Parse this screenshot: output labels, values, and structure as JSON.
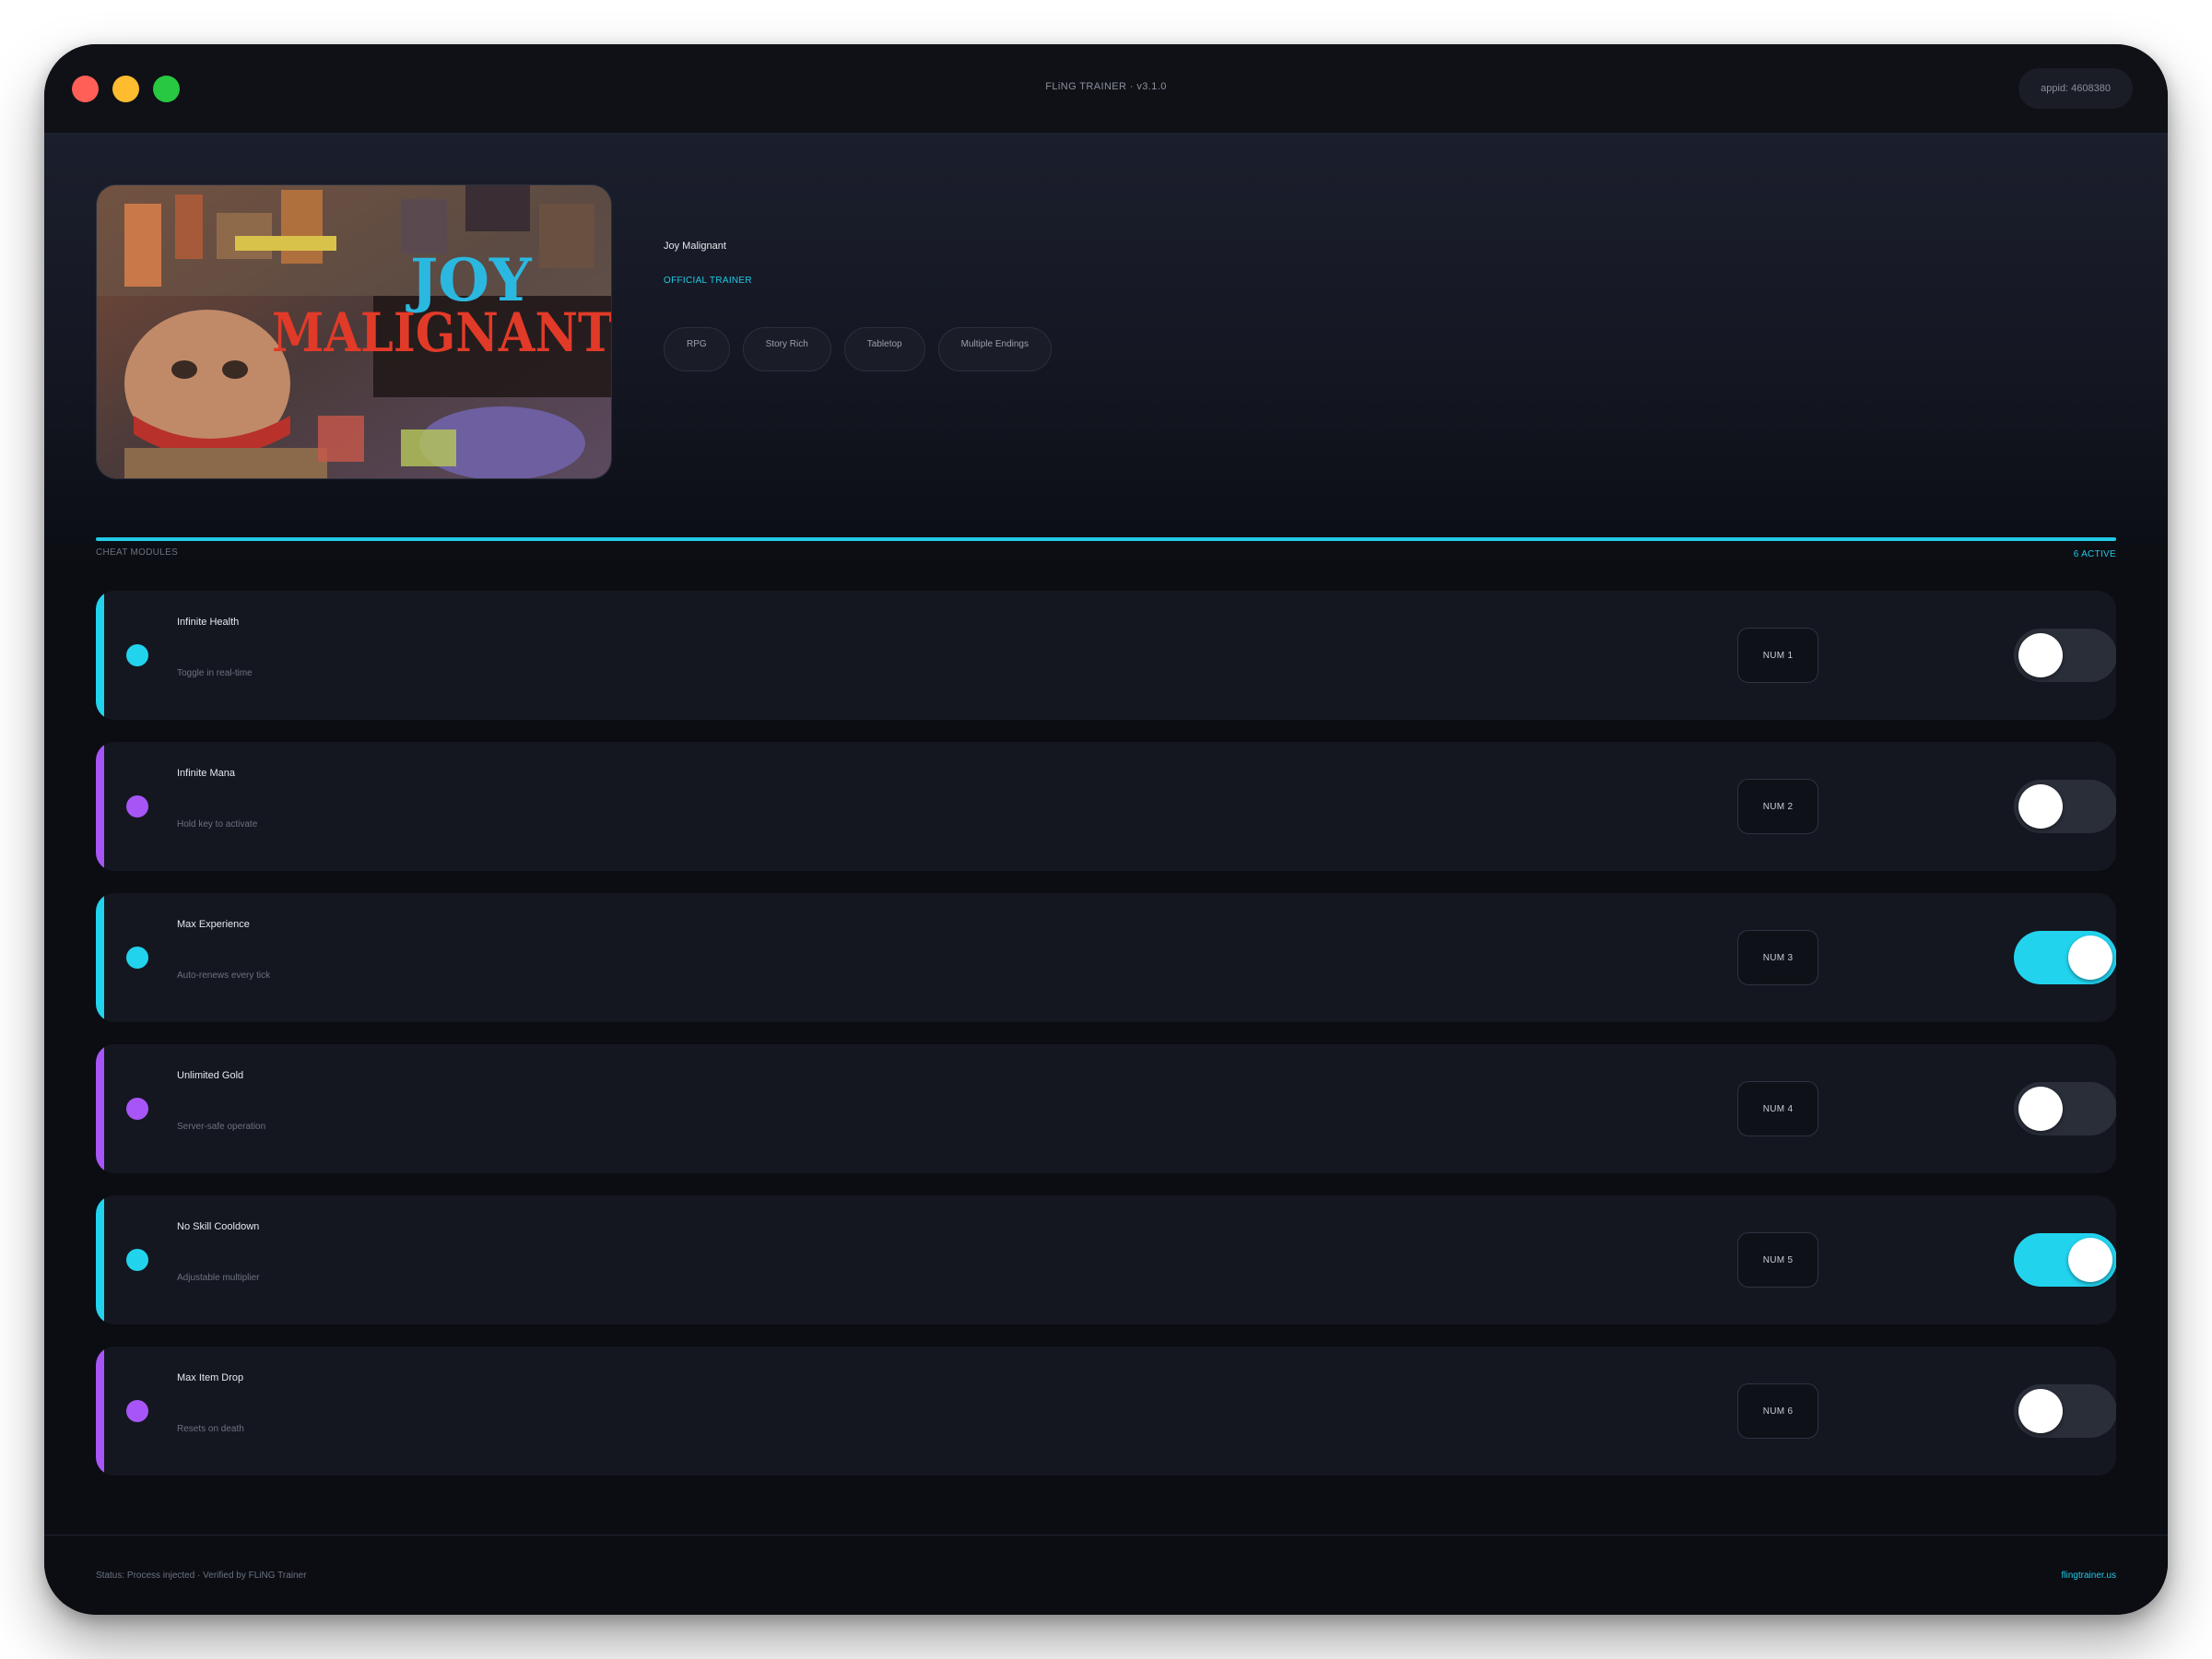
{
  "window": {
    "title": "FLiNG TRAINER · v3.1.0",
    "appid": "appid: 4608380"
  },
  "game": {
    "name": "Joy Malignant",
    "badge": "OFFICIAL TRAINER",
    "cover_title_line1": "JOY",
    "cover_title_line2": "MALIGNANT",
    "tags": [
      "RPG",
      "Story Rich",
      "Tabletop",
      "Multiple Endings"
    ]
  },
  "section": {
    "label": "CHEAT MODULES",
    "count": "6 ACTIVE"
  },
  "colors": {
    "cyan": "#22d3ee",
    "purple": "#a855f7",
    "toggle_off": "#2a2e39"
  },
  "cheats": [
    {
      "name": "Infinite Health",
      "desc": "Toggle in real-time",
      "key": "NUM 1",
      "accent": "#22d3ee",
      "on": false
    },
    {
      "name": "Infinite Mana",
      "desc": "Hold key to activate",
      "key": "NUM 2",
      "accent": "#a855f7",
      "on": false
    },
    {
      "name": "Max Experience",
      "desc": "Auto-renews every tick",
      "key": "NUM 3",
      "accent": "#22d3ee",
      "on": true
    },
    {
      "name": "Unlimited Gold",
      "desc": "Server-safe operation",
      "key": "NUM 4",
      "accent": "#a855f7",
      "on": false
    },
    {
      "name": "No Skill Cooldown",
      "desc": "Adjustable multiplier",
      "key": "NUM 5",
      "accent": "#22d3ee",
      "on": true
    },
    {
      "name": "Max Item Drop",
      "desc": "Resets on death",
      "key": "NUM 6",
      "accent": "#a855f7",
      "on": false
    }
  ],
  "footer": {
    "status": "Status: Process injected · Verified by FLiNG Trainer",
    "link": "flingtrainer.us"
  }
}
